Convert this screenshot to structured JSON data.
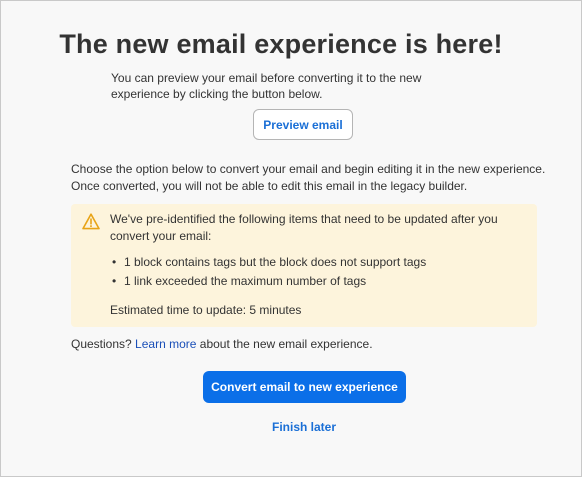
{
  "dialog": {
    "title": "The new email experience is here!",
    "intro": "You can preview your email before converting it to the new experience by clicking the button below.",
    "preview_button": "Preview email",
    "choose_text": "Choose the option below to convert your email and begin editing it in the new experience. Once converted, you will not be able to edit this email in the legacy builder.",
    "warning": {
      "icon": "warning-triangle-icon",
      "text": "We've pre-identified the following items that need to be updated after you convert your email:",
      "items": [
        "1 block contains tags but the block does not support tags",
        "1 link exceeded the maximum number of tags"
      ],
      "estimate": "Estimated time to update: 5 minutes"
    },
    "questions": {
      "prefix": "Questions?",
      "link": "Learn more",
      "suffix": "about the new email experience."
    },
    "convert_button": "Convert email to new experience",
    "finish_later": "Finish later"
  },
  "colors": {
    "primary": "#0b6fe8",
    "link": "#1a6fd6",
    "warning_bg": "#fdf4dc",
    "warning_icon": "#e8a417"
  }
}
